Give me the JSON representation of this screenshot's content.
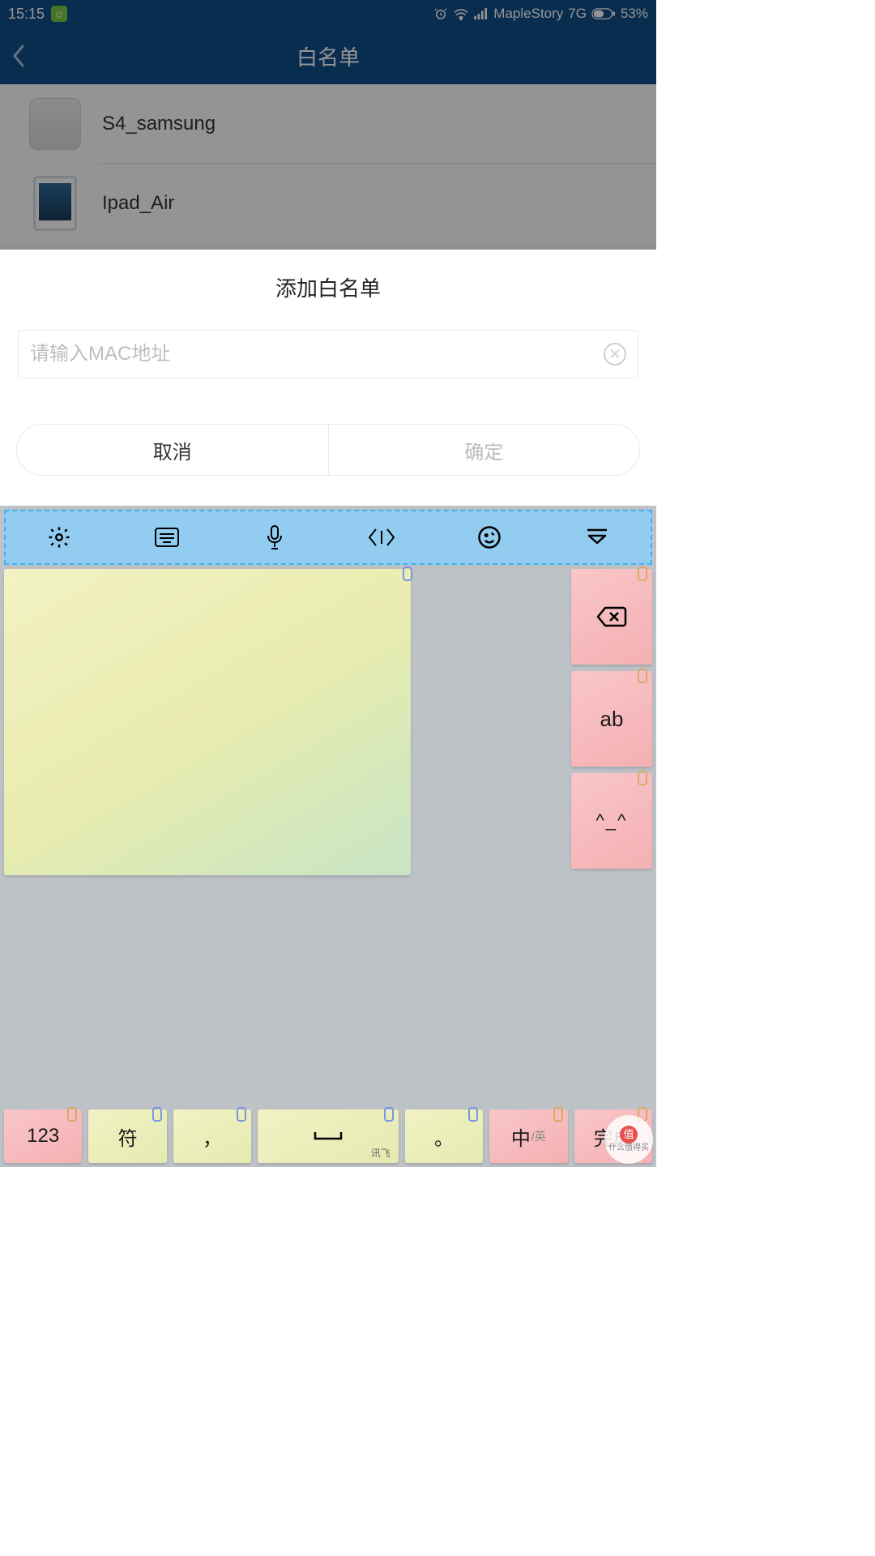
{
  "status": {
    "time": "15:15",
    "carrier": "MapleStory",
    "network": "7G",
    "battery": "53%"
  },
  "header": {
    "title": "白名单"
  },
  "devices": [
    {
      "name": "S4_samsung"
    },
    {
      "name": "Ipad_Air"
    }
  ],
  "modal": {
    "title": "添加白名单",
    "placeholder": "请输入MAC地址",
    "value": "",
    "cancel": "取消",
    "ok": "确定"
  },
  "keyboard": {
    "space_sub": "讯飞",
    "keys": {
      "ab": "ab",
      "kaomoji": "^_^",
      "num": "123",
      "sym": "符",
      "comma": "，",
      "space": "⌴",
      "period": "。",
      "lang_main": "中",
      "lang_sub": "/英",
      "done": "完成"
    }
  },
  "watermark": "什么值得买"
}
